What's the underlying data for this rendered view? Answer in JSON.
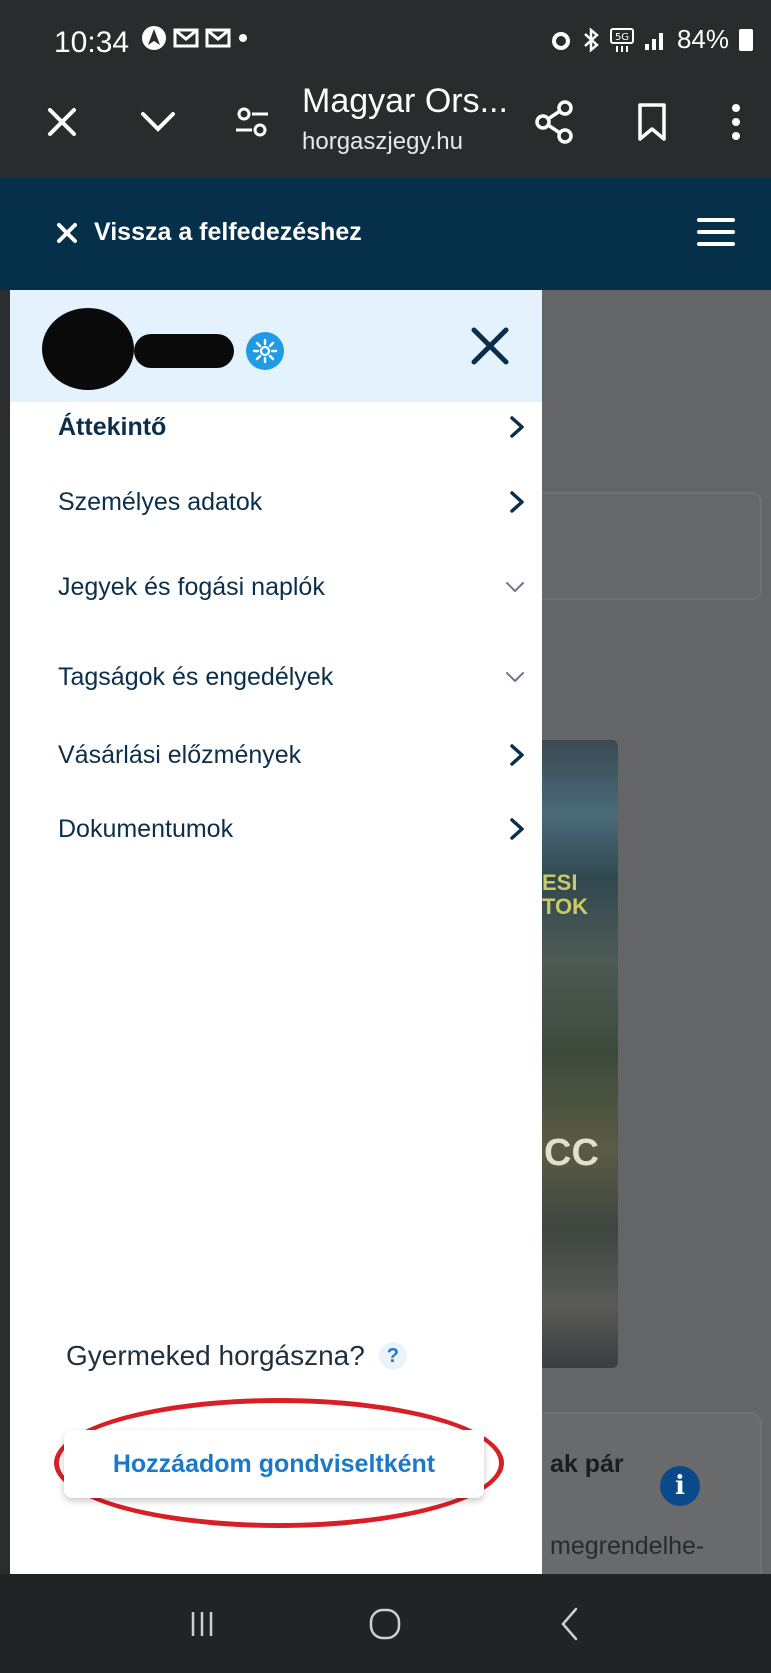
{
  "status_bar": {
    "time": "10:34",
    "left_icons": [
      "navigation-icon",
      "gmail-icon",
      "gmail-icon",
      "dot-icon"
    ],
    "battery": "84%",
    "right_icons": [
      "alarm-icon",
      "bluetooth-icon",
      "5g-icon",
      "signal-icon",
      "battery-icon"
    ]
  },
  "browser_toolbar": {
    "title": "Magyar Ors...",
    "url": "horgaszjegy.hu"
  },
  "page_header": {
    "back_label": "Vissza a felfedezéshez"
  },
  "drawer": {
    "menu_items": [
      {
        "label": "Áttekintő",
        "chevron": "right",
        "active": true
      },
      {
        "label": "Személyes adatok",
        "chevron": "right",
        "active": false
      },
      {
        "label": "Jegyek és fogási naplók",
        "chevron": "down",
        "active": false
      },
      {
        "label": "Tagságok és engedélyek",
        "chevron": "down",
        "active": false
      },
      {
        "label": "Vásárlási előzmények",
        "chevron": "right",
        "active": false
      },
      {
        "label": "Dokumentumok",
        "chevron": "right",
        "active": false
      }
    ],
    "question": "Gyermeked horgászna?",
    "help_mark": "?",
    "add_button": "Hozzáadom gondviseltként"
  },
  "background": {
    "magazine_text_1": "ESI",
    "magazine_text_2": "TOK",
    "magazine_text_3": "CC",
    "card_bold_text": "ak pár",
    "info_icon_glyph": "i",
    "card_text": "megrendelhe-"
  },
  "colors": {
    "header_bg": "#063049",
    "drawer_head_bg": "#e3f2fc",
    "accent_blue": "#1a79c9",
    "annotation_red": "#d81f26"
  }
}
